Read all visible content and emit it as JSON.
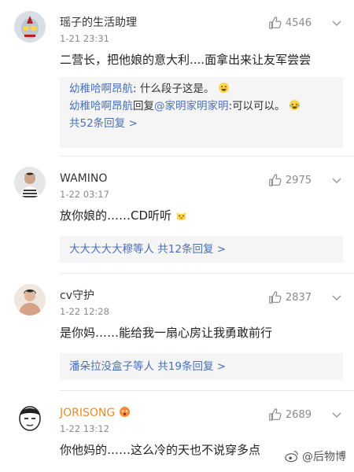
{
  "comments": [
    {
      "username": "瑶子的生活助理",
      "time": "1-21 23:31",
      "likes": "4546",
      "text": "二营长，把他娘的意大利....面拿出来让友军尝尝",
      "avatar_icon": "ultraman-avatar-icon",
      "replies": [
        {
          "author": "幼稚哈啊昂航",
          "sep": ": ",
          "content": "什么段子这是。"
        },
        {
          "author": "幼稚哈啊昂航",
          "mid": "回复",
          "mention": "@家明家明家明",
          "sep": ":",
          "content": "可以可以。"
        }
      ],
      "more_label": "共52条回复 >"
    },
    {
      "username": "WAMINO",
      "time": "1-22 03:17",
      "likes": "2975",
      "text": "放你娘的……CD听听",
      "avatar_icon": "user-photo-avatar-icon",
      "names_line": "大大大大大穆等人",
      "more_label": "共12条回复 >"
    },
    {
      "username": "cv守护",
      "time": "1-22 12:28",
      "likes": "2837",
      "text": "是你妈……能给我一扇心房让我勇敢前行",
      "avatar_icon": "user-photo-avatar-icon",
      "names_line": "潘朵拉没盒子等人",
      "more_label": "共19条回复 >"
    },
    {
      "username": "JORISONG",
      "time": "1-22 13:12",
      "likes": "2689",
      "text": "你他妈的……这么冷的天也不说穿多点",
      "avatar_icon": "cartoon-face-avatar-icon"
    }
  ],
  "watermark": "@后物博"
}
